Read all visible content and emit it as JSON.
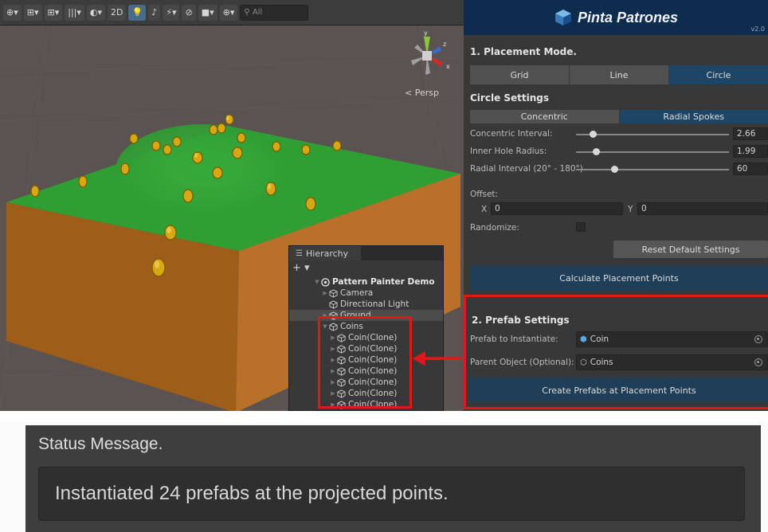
{
  "toolbar": {
    "items": [
      "⊕▾",
      "⊞▾",
      "⊞▾",
      "|||▾",
      "◐▾",
      "2D",
      "💡",
      "♪",
      "⚡▾",
      "⊘",
      "■▾",
      "⊕▾"
    ],
    "search_placeholder": "All"
  },
  "scene": {
    "persp_label": "< Persp",
    "gizmo_axes": {
      "y": "y",
      "z": "z",
      "x": "x"
    }
  },
  "hierarchy": {
    "tab_label": "Hierarchy",
    "add_label": "+ ▾",
    "rows": [
      {
        "label": "Pattern Painter Demo",
        "indent": 0
      },
      {
        "label": "Camera",
        "indent": 1
      },
      {
        "label": "Directional Light",
        "indent": 1
      },
      {
        "label": "Ground",
        "indent": 1
      },
      {
        "label": "Coins",
        "indent": 1
      },
      {
        "label": "Coin(Clone)",
        "indent": 2
      },
      {
        "label": "Coin(Clone)",
        "indent": 2
      },
      {
        "label": "Coin(Clone)",
        "indent": 2
      },
      {
        "label": "Coin(Clone)",
        "indent": 2
      },
      {
        "label": "Coin(Clone)",
        "indent": 2
      },
      {
        "label": "Coin(Clone)",
        "indent": 2
      },
      {
        "label": "Coin(Clone)",
        "indent": 2
      }
    ]
  },
  "panel": {
    "title": "Pinta Patrones",
    "version": "v2.0",
    "placement_mode": {
      "label": "1. Placement Mode.",
      "options": [
        "Grid",
        "Line",
        "Circle"
      ],
      "selected": "Circle"
    },
    "circle_settings": {
      "label": "Circle Settings",
      "options": [
        "Concentric",
        "Radial Spokes"
      ],
      "selected": "Radial Spokes",
      "concentric_interval": {
        "label": "Concentric Interval:",
        "value": "2.66",
        "fraction": 0.11
      },
      "inner_hole_radius": {
        "label": "Inner Hole Radius:",
        "value": "1.99",
        "fraction": 0.13
      },
      "radial_interval": {
        "label": "Radial Interval (20° - 180°)",
        "value": "60",
        "fraction": 0.25
      },
      "offset_label": "Offset:",
      "offset_x_label": "X",
      "offset_x": "0",
      "offset_y_label": "Y",
      "offset_y": "0",
      "randomize_label": "Randomize:",
      "reset_label": "Reset Default Settings",
      "calculate_label": "Calculate Placement Points"
    },
    "prefab_settings": {
      "label": "2. Prefab Settings",
      "prefab_label": "Prefab to Instantiate:",
      "prefab_value": "Coin",
      "parent_label": "Parent Object (Optional):",
      "parent_value": "Coins",
      "create_label": "Create Prefabs at Placement Points"
    }
  },
  "status": {
    "title": "Status Message.",
    "message": "Instantiated 24 prefabs at the projected points."
  },
  "colors": {
    "highlight": "#e0181b",
    "ground_top": "#2e9e32",
    "ground_side": "#b36a1e",
    "coin": "#e0b21a",
    "header": "#0d2c4e",
    "selected_segment": "#1c4566"
  }
}
